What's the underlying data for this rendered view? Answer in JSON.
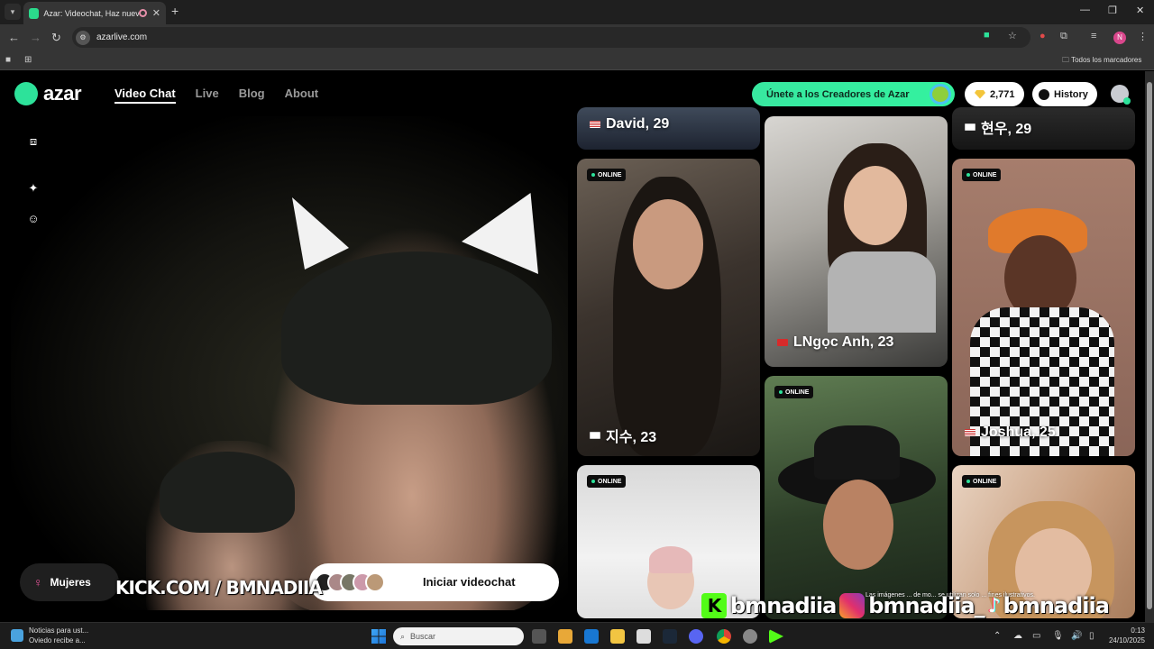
{
  "browser": {
    "tab_title": "Azar: Videochat, Haz nuevo",
    "url": "azarlive.com",
    "bookmarks_all": "Todos los marcadores",
    "profile_initial": "N"
  },
  "header": {
    "logo": "azar",
    "nav": [
      "Video Chat",
      "Live",
      "Blog",
      "About"
    ],
    "creators_cta": "Únete a los Creadores de Azar",
    "gems": "2,771",
    "history": "History"
  },
  "camera": {
    "gender_filter": "Mujeres",
    "start_button": "Iniciar videochat",
    "overlay_kick": "KICK.COM / BMNADIIA"
  },
  "profiles": {
    "online_label": "ONLINE",
    "cards": [
      {
        "name": "David, 29",
        "country": "us"
      },
      {
        "name": "지수, 23",
        "country": "kr"
      },
      {
        "name": "LNgọc Anh, 23",
        "country": "vn"
      },
      {
        "name": "현우, 29",
        "country": "kr"
      },
      {
        "name": "Joshua, 25",
        "country": "us"
      }
    ]
  },
  "overlay": {
    "disclaimer": "Las imágenes ... de mo... se utilizan solo ... fines ilustrativos.",
    "handle_kick": "bmnadiia",
    "handle_ig": "bmnadiia_",
    "handle_tiktok": "bmnadiia"
  },
  "taskbar": {
    "news_line1": "Noticias para ust...",
    "news_line2": "Oviedo recibe a...",
    "search_placeholder": "Buscar",
    "time": "0:13",
    "date": "24/10/2025"
  },
  "colors": {
    "brand": "#2de29a",
    "gender_icon": "#e9559a",
    "kick_green": "#53fc18"
  }
}
